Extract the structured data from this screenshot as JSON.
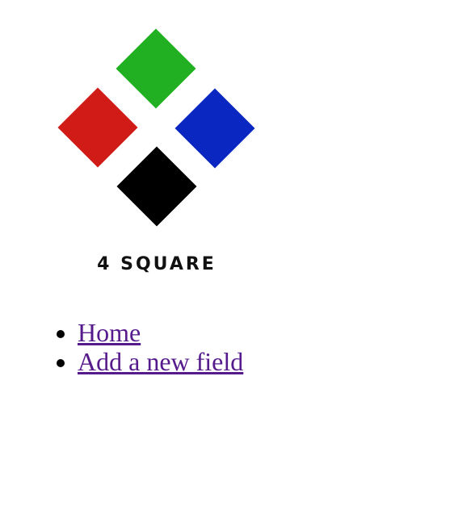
{
  "logo": {
    "text": "4 SQUARE",
    "colors": {
      "top": "#21b021",
      "left": "#d11b16",
      "right": "#0a27c1",
      "bottom": "#000000"
    }
  },
  "nav": {
    "items": [
      {
        "label": "Home"
      },
      {
        "label": "Add a new field"
      }
    ]
  },
  "link_color": "#551a8b"
}
